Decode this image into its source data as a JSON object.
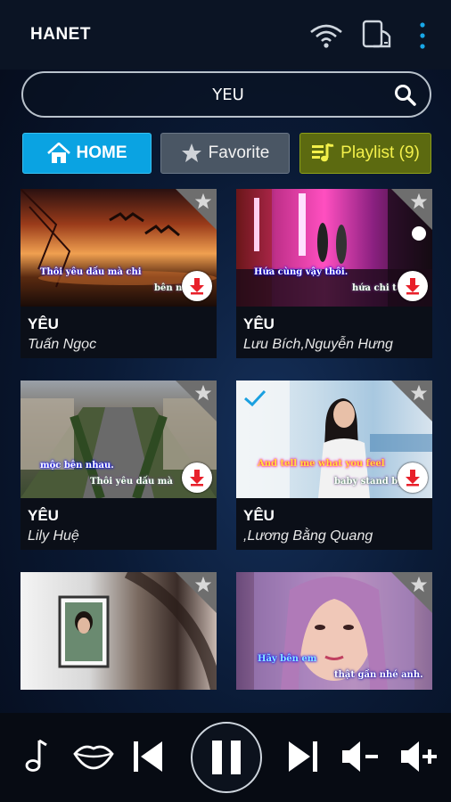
{
  "app": {
    "logo": "HANET"
  },
  "topbar": {
    "icons": [
      "wifi-icon",
      "device-cast-icon",
      "more-vertical-icon"
    ]
  },
  "search": {
    "value": "YEU",
    "icon": "search-icon"
  },
  "tabs": [
    {
      "label": "HOME",
      "icon": "home-icon",
      "active": true
    },
    {
      "label": "Favorite",
      "icon": "star-icon"
    },
    {
      "label": "Playlist (9)",
      "icon": "playlist-icon"
    }
  ],
  "songs": [
    {
      "title": "YÊU",
      "artist": "Tuấn Ngọc",
      "cap1": "Thôi yêu dấu mà chi",
      "cap2": "bên nh"
    },
    {
      "title": "YÊU",
      "artist": "Lưu Bích,Nguyễn Hưng",
      "cap1": "Hứa cùng vậy thôi.",
      "cap2": "hứa chi t"
    },
    {
      "title": "YÊU",
      "artist": "Lily Huệ",
      "cap1": "mộc bên nhau.",
      "cap2": "Thôi yêu dấu mà"
    },
    {
      "title": "YÊU",
      "artist": ",Lương Bằng Quang",
      "cap1": "And tell me what you feel",
      "cap2": "baby stand by"
    },
    {
      "title": "",
      "artist": "",
      "cap1": "",
      "cap2": ""
    },
    {
      "title": "",
      "artist": "",
      "cap1": "Hãy bên em",
      "cap2": "thật gần nhé anh."
    }
  ],
  "player": {
    "buttons": [
      "music-note-icon",
      "lips-icon",
      "previous-icon",
      "pause-icon",
      "next-icon",
      "volume-down-icon",
      "volume-up-icon"
    ]
  },
  "colors": {
    "accent": "#0aa3e2",
    "playlist": "#f3f04a",
    "download": "#e8202a"
  }
}
